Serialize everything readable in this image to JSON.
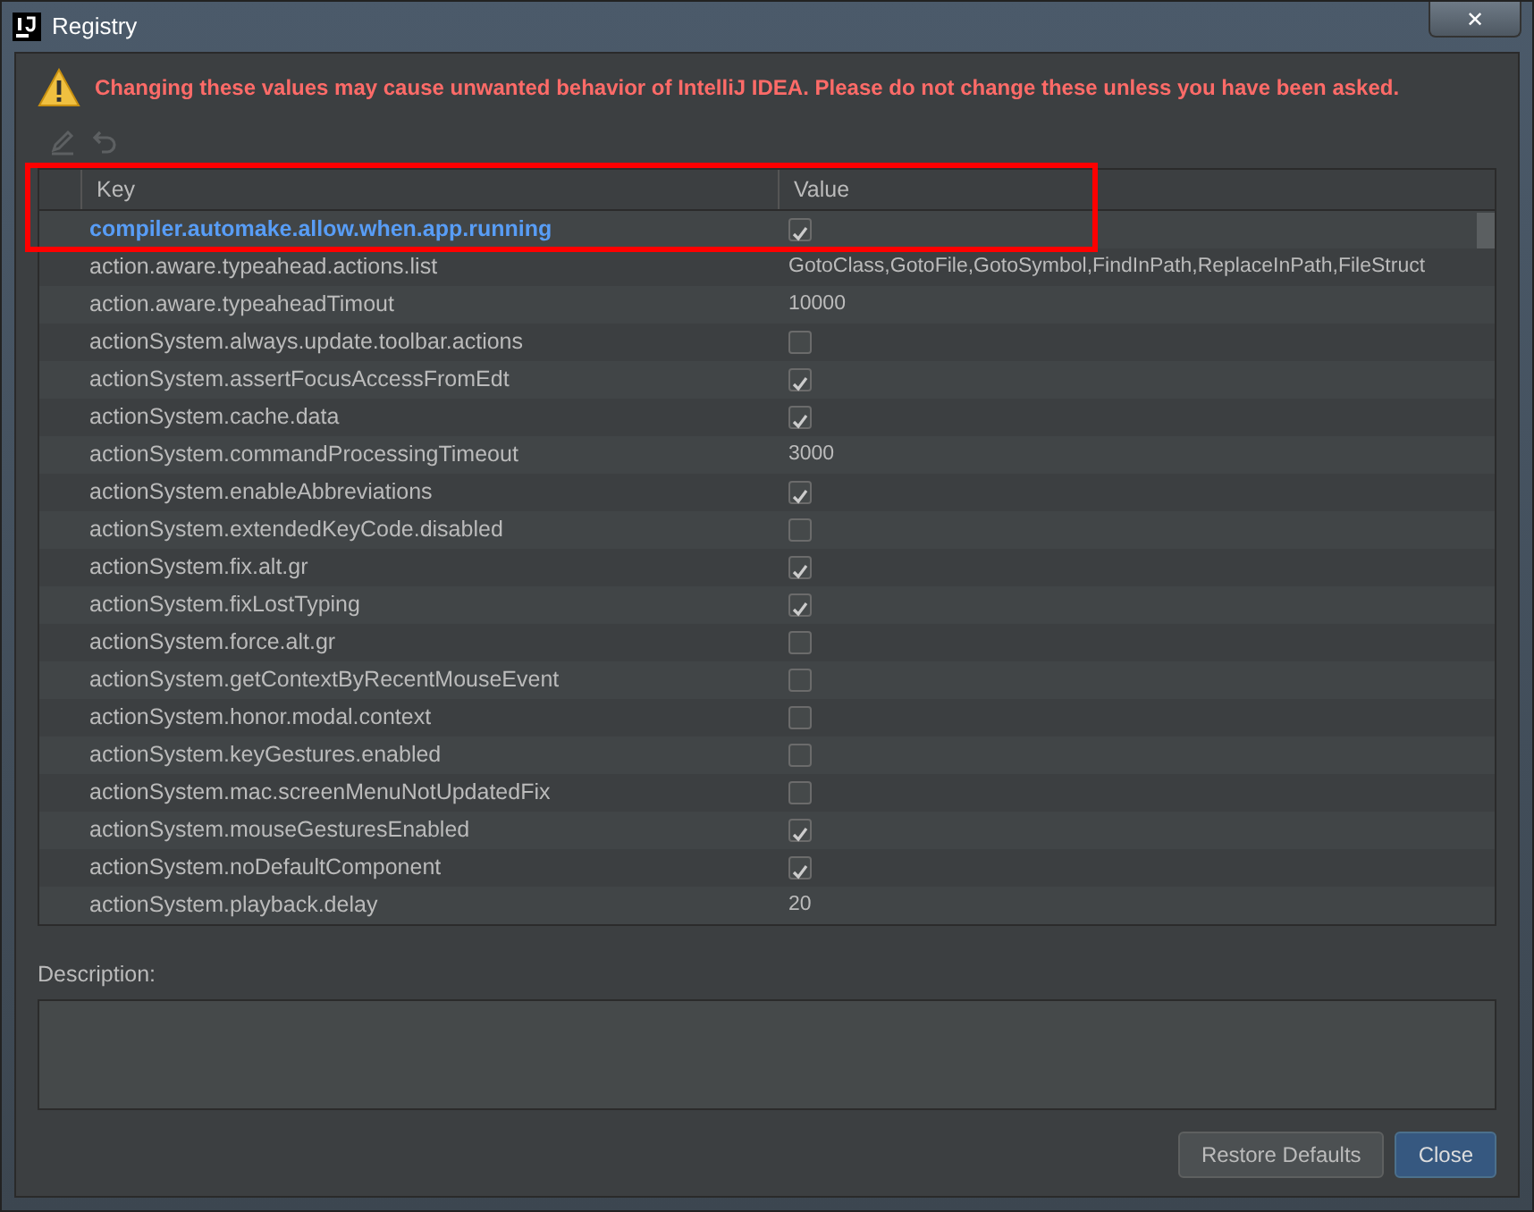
{
  "window": {
    "title": "Registry",
    "close_label": "✕"
  },
  "warning": "Changing these values may cause unwanted behavior of IntelliJ IDEA. Please do not change these unless you have been asked.",
  "toolbar": [
    {
      "kind": "edit",
      "disabled": true
    },
    {
      "kind": "revert",
      "disabled": true
    }
  ],
  "table": {
    "columns": [
      "Key",
      "Value"
    ],
    "rows": [
      {
        "key": "compiler.automake.allow.when.app.running",
        "kind": "checkbox",
        "checked": true,
        "selected": true,
        "annotated": true
      },
      {
        "key": "action.aware.typeahead.actions.list",
        "kind": "text",
        "value": "GotoClass,GotoFile,GotoSymbol,FindInPath,ReplaceInPath,FileStruct",
        "selected": false,
        "annotated": false
      },
      {
        "key": "action.aware.typeaheadTimout",
        "kind": "text",
        "value": "10000",
        "selected": false,
        "annotated": false
      },
      {
        "key": "actionSystem.always.update.toolbar.actions",
        "kind": "checkbox",
        "checked": false,
        "selected": false,
        "annotated": false
      },
      {
        "key": "actionSystem.assertFocusAccessFromEdt",
        "kind": "checkbox",
        "checked": true,
        "selected": false,
        "annotated": false
      },
      {
        "key": "actionSystem.cache.data",
        "kind": "checkbox",
        "checked": true,
        "selected": false,
        "annotated": false
      },
      {
        "key": "actionSystem.commandProcessingTimeout",
        "kind": "text",
        "value": "3000",
        "selected": false,
        "annotated": false
      },
      {
        "key": "actionSystem.enableAbbreviations",
        "kind": "checkbox",
        "checked": true,
        "selected": false,
        "annotated": false
      },
      {
        "key": "actionSystem.extendedKeyCode.disabled",
        "kind": "checkbox",
        "checked": false,
        "selected": false,
        "annotated": false
      },
      {
        "key": "actionSystem.fix.alt.gr",
        "kind": "checkbox",
        "checked": true,
        "selected": false,
        "annotated": false
      },
      {
        "key": "actionSystem.fixLostTyping",
        "kind": "checkbox",
        "checked": true,
        "selected": false,
        "annotated": false
      },
      {
        "key": "actionSystem.force.alt.gr",
        "kind": "checkbox",
        "checked": false,
        "selected": false,
        "annotated": false
      },
      {
        "key": "actionSystem.getContextByRecentMouseEvent",
        "kind": "checkbox",
        "checked": false,
        "selected": false,
        "annotated": false
      },
      {
        "key": "actionSystem.honor.modal.context",
        "kind": "checkbox",
        "checked": false,
        "selected": false,
        "annotated": false
      },
      {
        "key": "actionSystem.keyGestures.enabled",
        "kind": "checkbox",
        "checked": false,
        "selected": false,
        "annotated": false
      },
      {
        "key": "actionSystem.mac.screenMenuNotUpdatedFix",
        "kind": "checkbox",
        "checked": false,
        "selected": false,
        "annotated": false
      },
      {
        "key": "actionSystem.mouseGesturesEnabled",
        "kind": "checkbox",
        "checked": true,
        "selected": false,
        "annotated": false
      },
      {
        "key": "actionSystem.noDefaultComponent",
        "kind": "checkbox",
        "checked": true,
        "selected": false,
        "annotated": false
      },
      {
        "key": "actionSystem.playback.delay",
        "kind": "text",
        "value": "20",
        "selected": false,
        "annotated": false
      }
    ]
  },
  "description": {
    "label": "Description:"
  },
  "buttons": [
    {
      "label": "Restore Defaults",
      "default": false
    },
    {
      "label": "Close",
      "default": true
    }
  ]
}
